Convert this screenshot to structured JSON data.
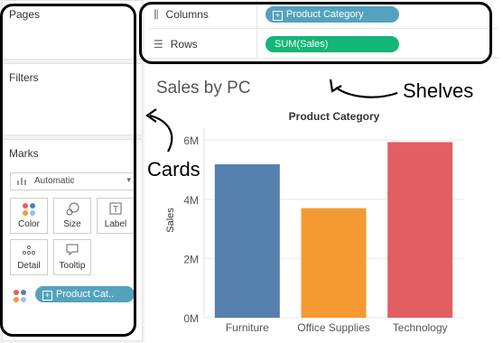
{
  "cards": {
    "pages": {
      "title": "Pages"
    },
    "filters": {
      "title": "Filters"
    },
    "marks": {
      "title": "Marks",
      "mark_type": "Automatic",
      "buttons": [
        {
          "label": "Color",
          "icon": "color-dots-icon"
        },
        {
          "label": "Size",
          "icon": "size-icon"
        },
        {
          "label": "Label",
          "icon": "label-icon"
        },
        {
          "label": "Detail",
          "icon": "detail-icon"
        },
        {
          "label": "Tooltip",
          "icon": "tooltip-icon"
        }
      ],
      "color_pill": "Product Cat.."
    }
  },
  "shelves": {
    "columns": {
      "label": "Columns",
      "pill": "Product Category"
    },
    "rows": {
      "label": "Rows",
      "pill": "SUM(Sales)"
    }
  },
  "annotations": {
    "shelves": "Shelves",
    "cards": "Cards"
  },
  "colors": {
    "dimension_pill": "#55a2bd",
    "measure_pill": "#14b578",
    "furniture": "#5580ad",
    "office_supplies": "#f49a32",
    "technology": "#e15f63"
  },
  "chart_data": {
    "type": "bar",
    "title": "Sales by PC",
    "xlabel": "Product Category",
    "ylabel": "Sales",
    "categories": [
      "Furniture",
      "Office Supplies",
      "Technology"
    ],
    "values": [
      5.18,
      3.7,
      5.93
    ],
    "y_ticks": [
      "0M",
      "2M",
      "4M",
      "6M"
    ],
    "ylim": [
      0,
      6.4
    ],
    "unit": "M",
    "grid": true
  }
}
